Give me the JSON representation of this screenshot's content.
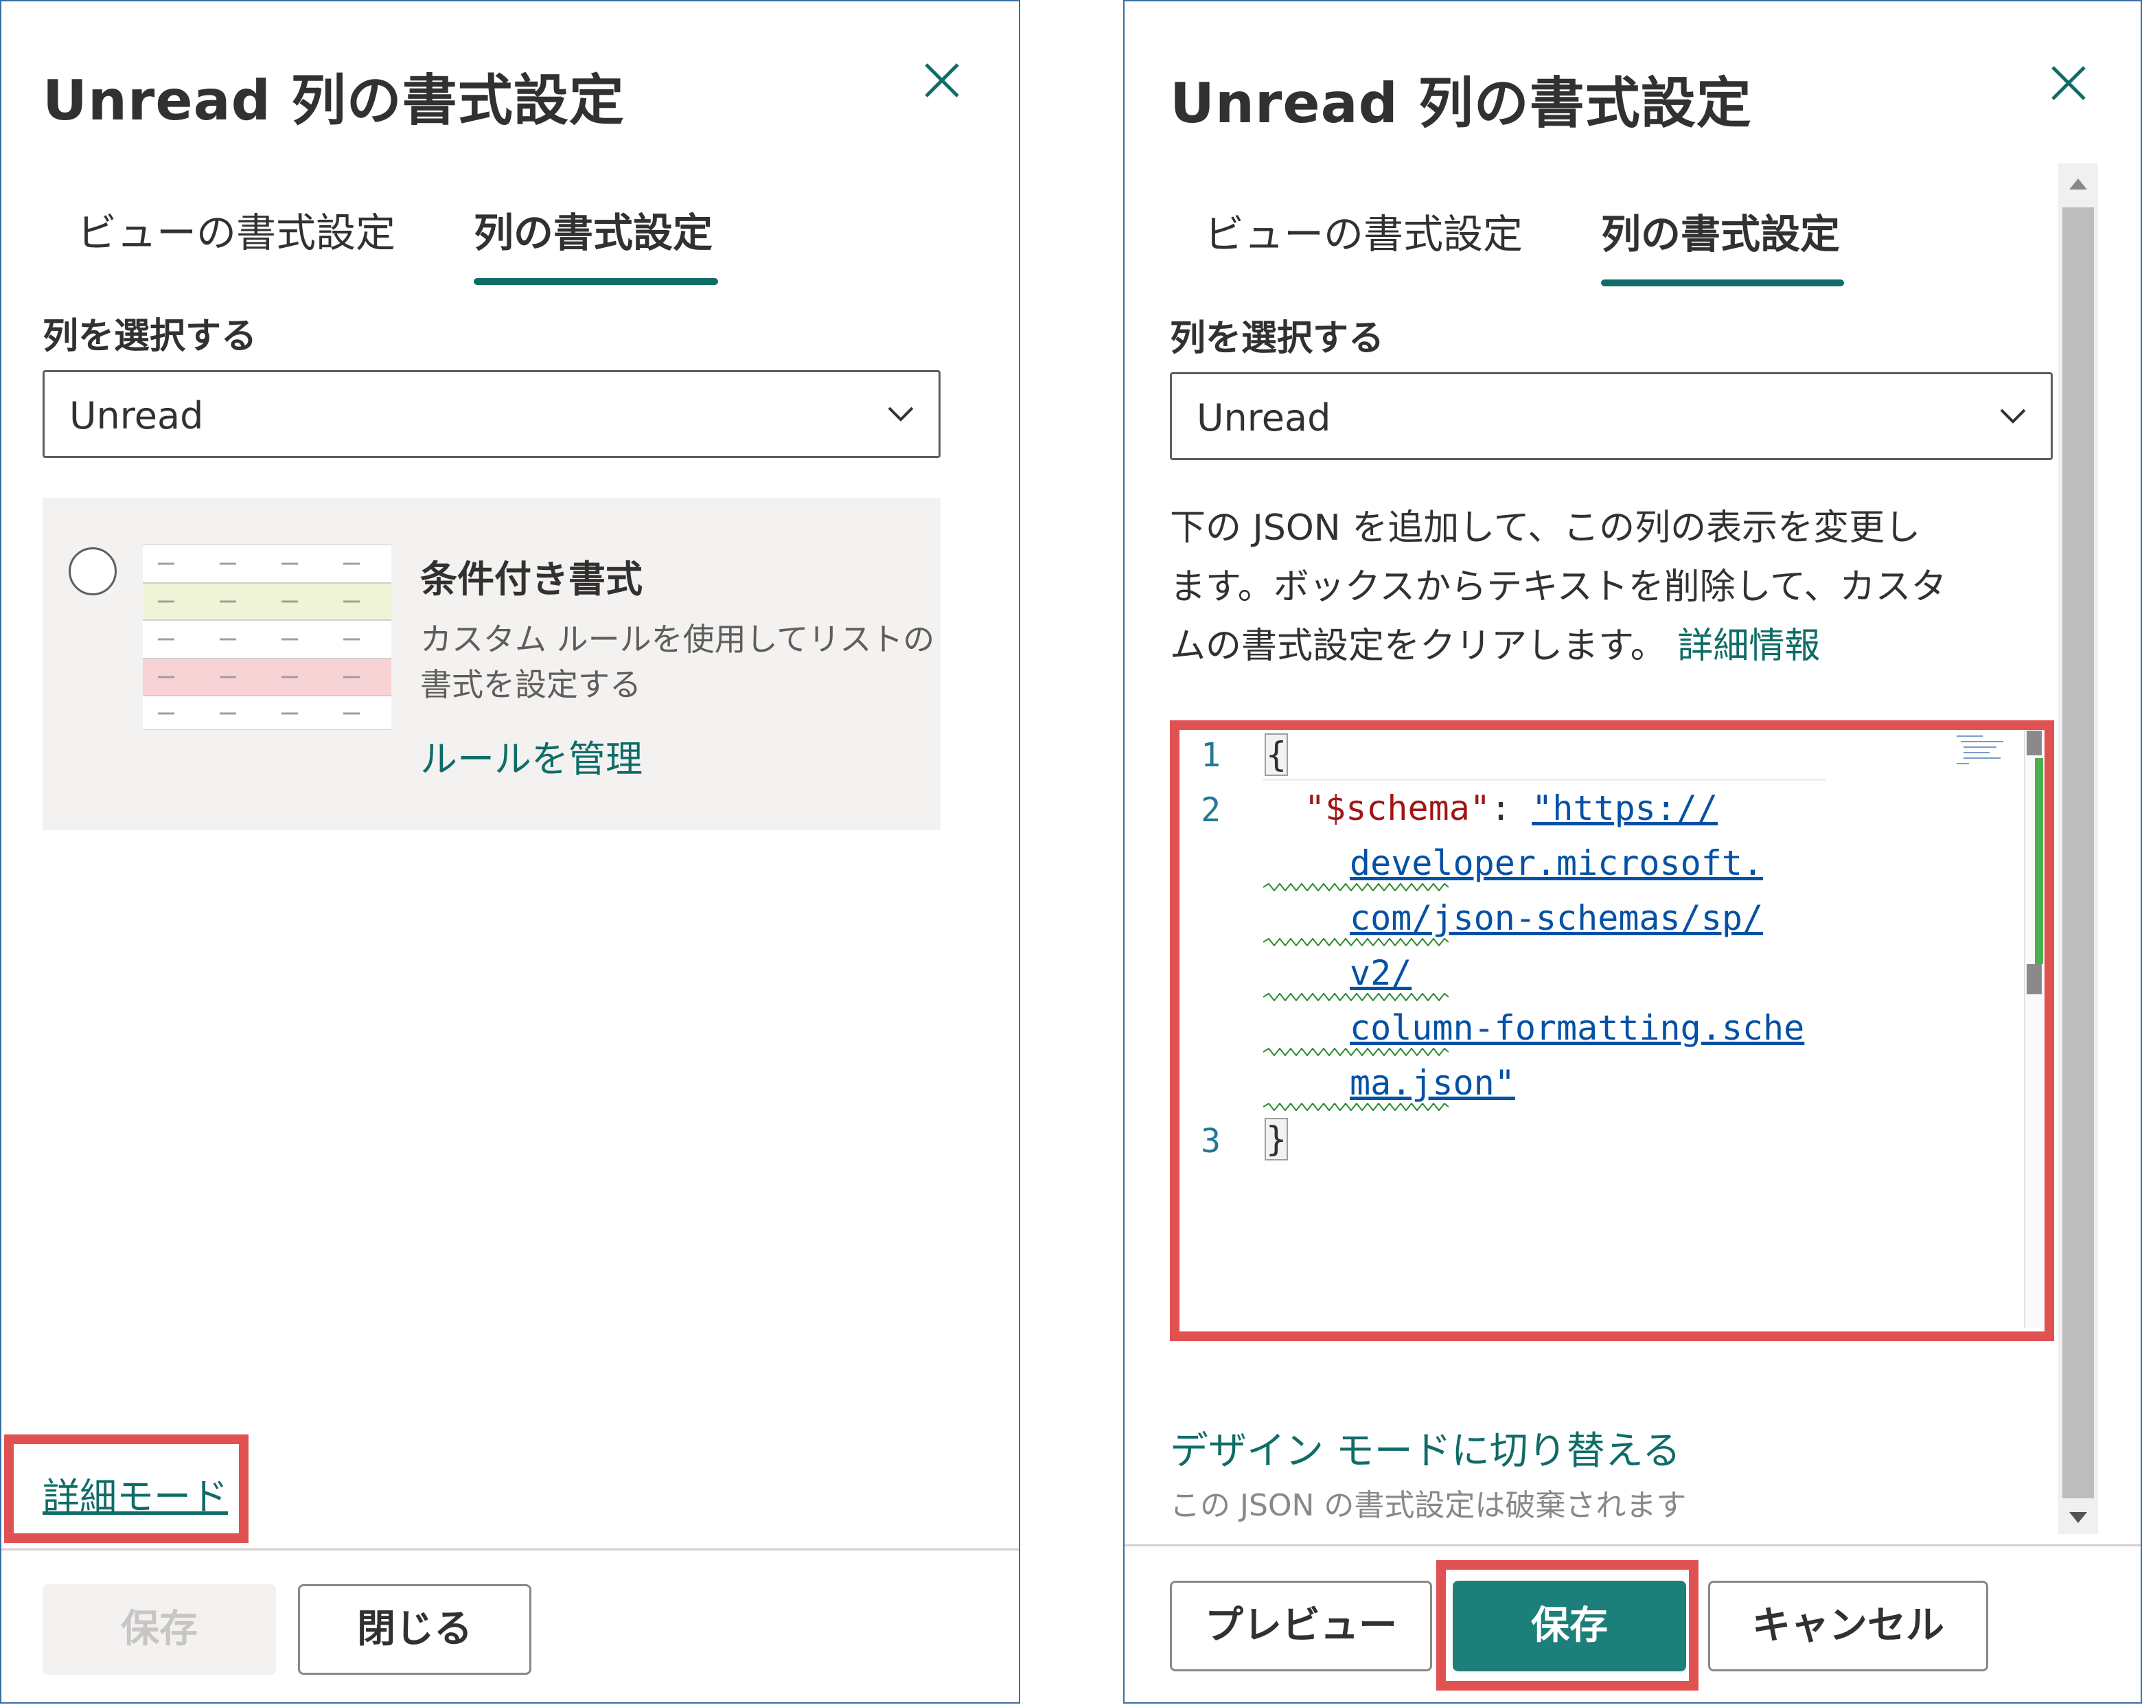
{
  "left": {
    "title": "Unread 列の書式設定",
    "tabs": [
      {
        "label": "ビューの書式設定",
        "active": false
      },
      {
        "label": "列の書式設定",
        "active": true
      }
    ],
    "select_label": "列を選択する",
    "select_value": "Unread",
    "option": {
      "title": "条件付き書式",
      "description_line1": "カスタム ルールを使用してリストの",
      "description_line2": "書式を設定する",
      "link": "ルールを管理"
    },
    "advanced_mode_link": "詳細モード",
    "buttons": {
      "save": "保存",
      "close": "閉じる"
    }
  },
  "right": {
    "title": "Unread 列の書式設定",
    "tabs": [
      {
        "label": "ビューの書式設定",
        "active": false
      },
      {
        "label": "列の書式設定",
        "active": true
      }
    ],
    "select_label": "列を選択する",
    "select_value": "Unread",
    "description_line1": "下の JSON を追加して、この列の表示を変更し",
    "description_line2": "ます。ボックスからテキストを削除して、カスタ",
    "description_line3": "ムの書式設定をクリアします。",
    "learn_more": "詳細情報",
    "editor": {
      "line_numbers": [
        "1",
        "2",
        "3"
      ],
      "open_brace": "{",
      "key": "\"$schema\"",
      "colon": ":",
      "value_lines": [
        "\"https://",
        "developer.microsoft.",
        "com/json-schemas/sp/",
        "v2/",
        "column-formatting.sche",
        "ma.json\""
      ],
      "close_brace": "}"
    },
    "design_mode_link": "デザイン モードに切り替える",
    "design_mode_note": "この JSON の書式設定は破棄されます",
    "buttons": {
      "preview": "プレビュー",
      "save": "保存",
      "cancel": "キャンセル"
    }
  },
  "colors": {
    "accent": "#0f6c67",
    "primary_button": "#1c7f7a",
    "highlight": "#e05252",
    "json_key": "#a31515",
    "json_value": "#0451a5",
    "line_number": "#237893",
    "squiggle": "#2b8a2b",
    "rule_yellow": "#f0f4d6",
    "rule_red": "#f8d3d6"
  }
}
